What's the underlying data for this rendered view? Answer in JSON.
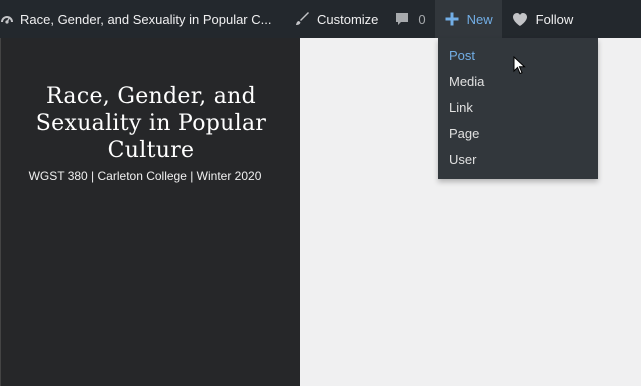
{
  "adminbar": {
    "site_name": "Race, Gender, and Sexuality in Popular C...",
    "customize_label": "Customize",
    "comments_count": "0",
    "new_label": "New",
    "follow_label": "Follow"
  },
  "new_menu": {
    "items": [
      {
        "label": "Post"
      },
      {
        "label": "Media"
      },
      {
        "label": "Link"
      },
      {
        "label": "Page"
      },
      {
        "label": "User"
      }
    ]
  },
  "site": {
    "title": "Race, Gender, and Sexuality in Popular Culture",
    "description": "WGST 380 | Carleton College | Winter 2020"
  },
  "colors": {
    "adminbar_bg": "#23282d",
    "accent": "#72aee6",
    "sidebar_bg": "#262729",
    "content_bg": "#f0f0f1"
  },
  "icons": {
    "site": "dashboard-icon",
    "customize": "paintbrush-icon",
    "comments": "comment-bubble-icon",
    "new": "plus-icon",
    "follow": "heart-icon"
  }
}
